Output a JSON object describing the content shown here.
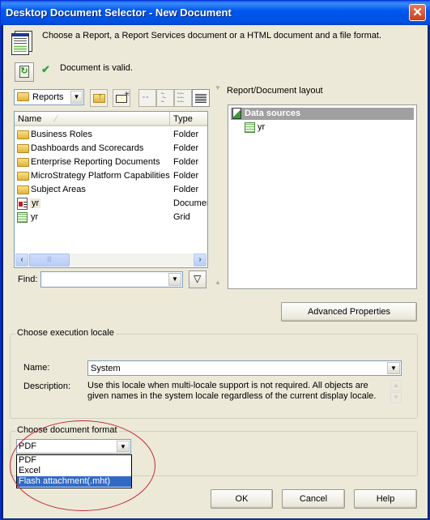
{
  "window": {
    "title": "Desktop Document Selector - New Document",
    "close_label": "✕"
  },
  "header": {
    "instruction": "Choose a Report, a Report Services document or a HTML document and a file format.",
    "validation_status": "Document is valid."
  },
  "browser": {
    "folder_combo_value": "Reports",
    "toolbar_icons": [
      "up-folder-icon",
      "new-folder-icon",
      "large-icons-view-icon",
      "small-icons-view-icon",
      "list-view-icon",
      "details-view-icon"
    ],
    "columns": {
      "name": "Name",
      "type": "Type"
    },
    "items": [
      {
        "name": "Business Roles",
        "type": "Folder",
        "icon": "folder-icon"
      },
      {
        "name": "Dashboards and Scorecards",
        "type": "Folder",
        "icon": "folder-icon"
      },
      {
        "name": "Enterprise Reporting Documents",
        "type": "Folder",
        "icon": "folder-icon"
      },
      {
        "name": "MicroStrategy Platform Capabilities",
        "type": "Folder",
        "icon": "folder-icon"
      },
      {
        "name": "Subject Areas",
        "type": "Folder",
        "icon": "folder-icon"
      },
      {
        "name": "yr",
        "type": "Documer",
        "icon": "document-icon"
      },
      {
        "name": "yr",
        "type": "Grid",
        "icon": "grid-icon"
      }
    ],
    "find_label": "Find:",
    "find_value": ""
  },
  "layout_panel": {
    "label": "Report/Document layout",
    "root": "Data sources",
    "children": [
      "yr"
    ]
  },
  "advanced_properties_label": "Advanced Properties",
  "locale": {
    "group_label": "Choose execution locale",
    "name_label": "Name:",
    "name_value": "System",
    "description_label": "Description:",
    "description": "Use this locale when multi-locale support is not required. All objects are given names in the system locale regardless of the current display locale."
  },
  "format": {
    "group_label": "Choose document format",
    "selected": "PDF",
    "options": [
      "PDF",
      "Excel",
      "Flash attachment(.mht)"
    ],
    "highlighted": "Flash attachment(.mht)"
  },
  "buttons": {
    "ok": "OK",
    "cancel": "Cancel",
    "help": "Help"
  },
  "colors": {
    "title_bar": "#0054e3",
    "selection": "#316ac5",
    "annotation_ellipse": "#c0283a",
    "dialog_bg": "#ece9d8"
  }
}
